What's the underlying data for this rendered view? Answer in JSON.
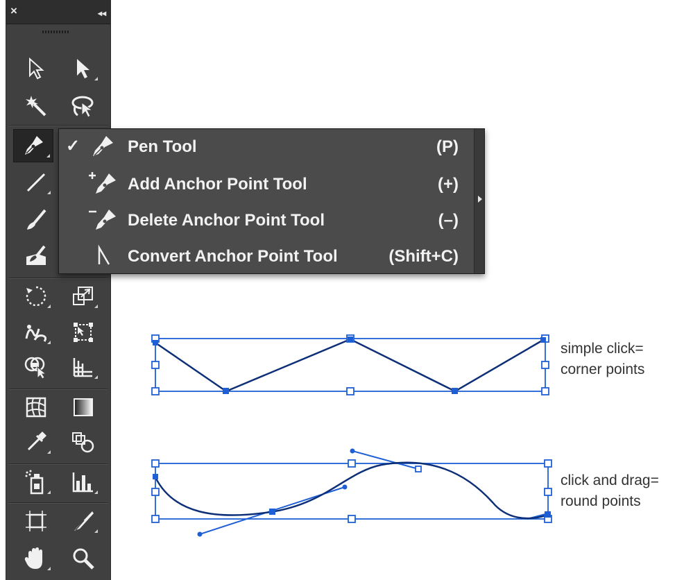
{
  "toolbar": {
    "close_glyph": "×",
    "collapse_glyph": "◂◂",
    "tools": [
      {
        "name": "selection-tool",
        "icon": "arrow-icon"
      },
      {
        "name": "direct-selection-tool",
        "icon": "white-arrow-icon"
      },
      {
        "name": "magic-wand-tool",
        "icon": "magic-wand-icon"
      },
      {
        "name": "lasso-tool",
        "icon": "lasso-icon"
      },
      {
        "name": "pen-tool",
        "icon": "pen-icon",
        "selected": true
      },
      {
        "name": "line-segment-tool",
        "icon": "line-icon"
      },
      {
        "name": "paintbrush-tool",
        "icon": "brush-icon"
      },
      {
        "name": "blob-brush-tool",
        "icon": "blob-brush-icon"
      },
      {
        "name": "rotate-tool",
        "icon": "rotate-icon"
      },
      {
        "name": "scale-tool",
        "icon": "scale-icon"
      },
      {
        "name": "warp-tool",
        "icon": "warp-icon"
      },
      {
        "name": "free-transform-tool",
        "icon": "free-transform-icon"
      },
      {
        "name": "shape-builder-tool",
        "icon": "shape-builder-icon"
      },
      {
        "name": "perspective-grid-tool",
        "icon": "perspective-grid-icon"
      },
      {
        "name": "mesh-tool",
        "icon": "mesh-icon"
      },
      {
        "name": "gradient-tool",
        "icon": "gradient-icon"
      },
      {
        "name": "eyedropper-tool",
        "icon": "eyedropper-icon"
      },
      {
        "name": "blend-tool",
        "icon": "blend-icon"
      },
      {
        "name": "symbol-sprayer-tool",
        "icon": "symbol-sprayer-icon"
      },
      {
        "name": "column-graph-tool",
        "icon": "column-graph-icon"
      },
      {
        "name": "artboard-tool",
        "icon": "artboard-icon"
      },
      {
        "name": "slice-tool",
        "icon": "slice-icon"
      },
      {
        "name": "hand-tool",
        "icon": "hand-icon"
      },
      {
        "name": "zoom-tool",
        "icon": "zoom-icon"
      }
    ]
  },
  "flyout": {
    "items": [
      {
        "label": "Pen Tool",
        "shortcut": "(P)",
        "checked": true,
        "icon": "pen-icon"
      },
      {
        "label": "Add Anchor Point Tool",
        "shortcut": "(+)",
        "checked": false,
        "icon": "add-anchor-point-icon"
      },
      {
        "label": "Delete Anchor Point Tool",
        "shortcut": "(–)",
        "checked": false,
        "icon": "delete-anchor-point-icon"
      },
      {
        "label": "Convert Anchor Point Tool",
        "shortcut": "(Shift+C)",
        "checked": false,
        "icon": "convert-anchor-point-icon"
      }
    ],
    "checkmark": "✓"
  },
  "illustration": {
    "corner": {
      "line1": "simple click=",
      "line2": "corner points"
    },
    "round": {
      "line1": "click and drag=",
      "line2": "round points"
    },
    "accent_color": "#1e5fd6",
    "path_color": "#0d2f78"
  }
}
